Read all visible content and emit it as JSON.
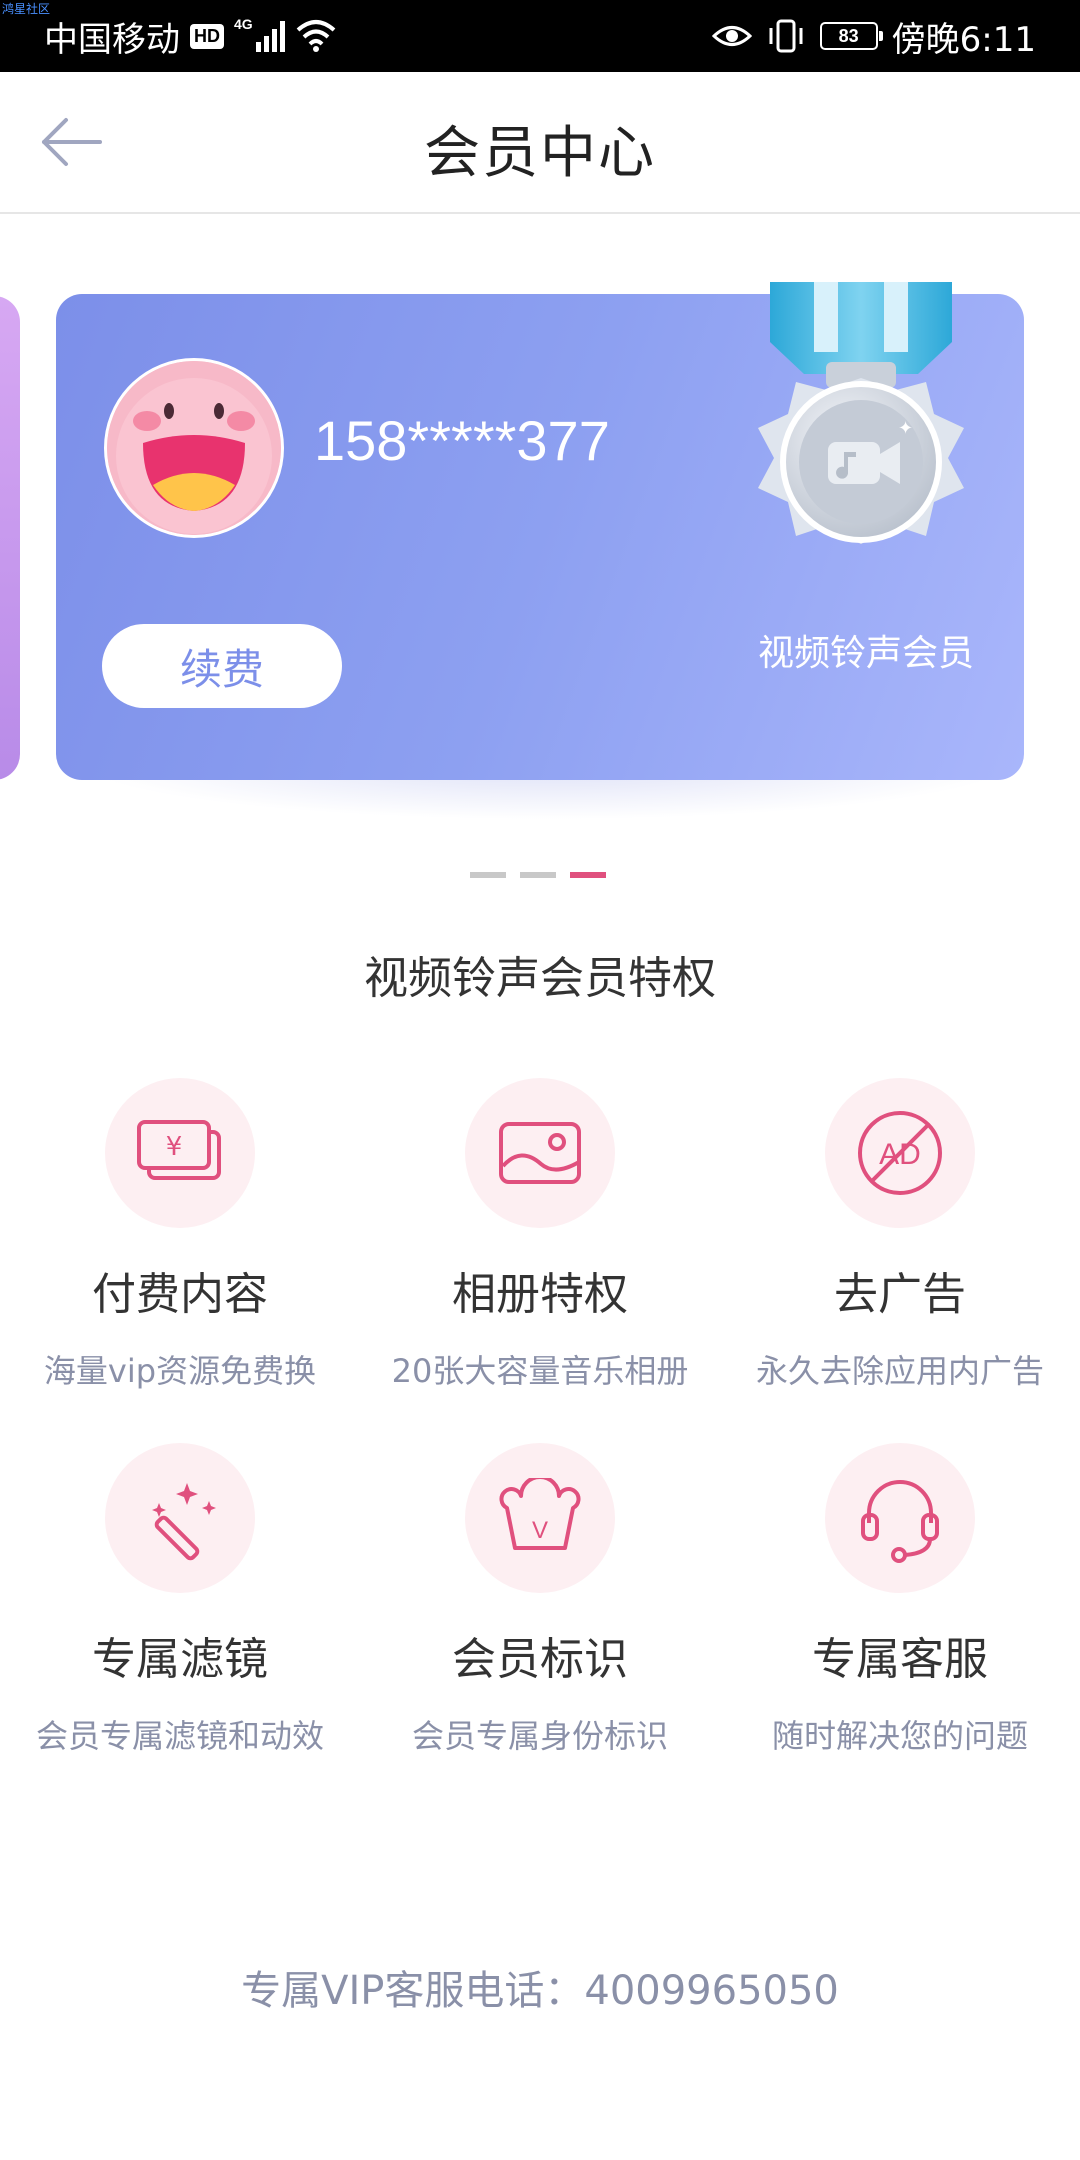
{
  "status_bar": {
    "tiny_label": "鸿星社区",
    "carrier": "中国移动",
    "hd": "HD",
    "network": "4G",
    "battery": "83",
    "time": "傍晚6:11"
  },
  "header": {
    "title": "会员中心"
  },
  "card": {
    "phone": "158*****377",
    "renew_label": "续费",
    "membership_name": "视频铃声会员"
  },
  "carousel": {
    "active_index": 2,
    "count": 3
  },
  "privileges": {
    "title": "视频铃声会员特权",
    "items": [
      {
        "icon": "money-icon",
        "title": "付费内容",
        "desc": "海量vip资源免费换"
      },
      {
        "icon": "album-icon",
        "title": "相册特权",
        "desc": "20张大容量音乐相册"
      },
      {
        "icon": "no-ad-icon",
        "title": "去广告",
        "desc": "永久去除应用内广告"
      },
      {
        "icon": "magic-wand-icon",
        "title": "专属滤镜",
        "desc": "会员专属滤镜和动效"
      },
      {
        "icon": "crown-icon",
        "title": "会员标识",
        "desc": "会员专属身份标识"
      },
      {
        "icon": "headset-icon",
        "title": "专属客服",
        "desc": "随时解决您的问题"
      }
    ]
  },
  "hotline": "专属VIP客服电话：4009965050",
  "colors": {
    "accent": "#e0507e",
    "card_start": "#7c8fe9",
    "card_end": "#a9b6fb",
    "icon_bg": "#fdeff2"
  }
}
